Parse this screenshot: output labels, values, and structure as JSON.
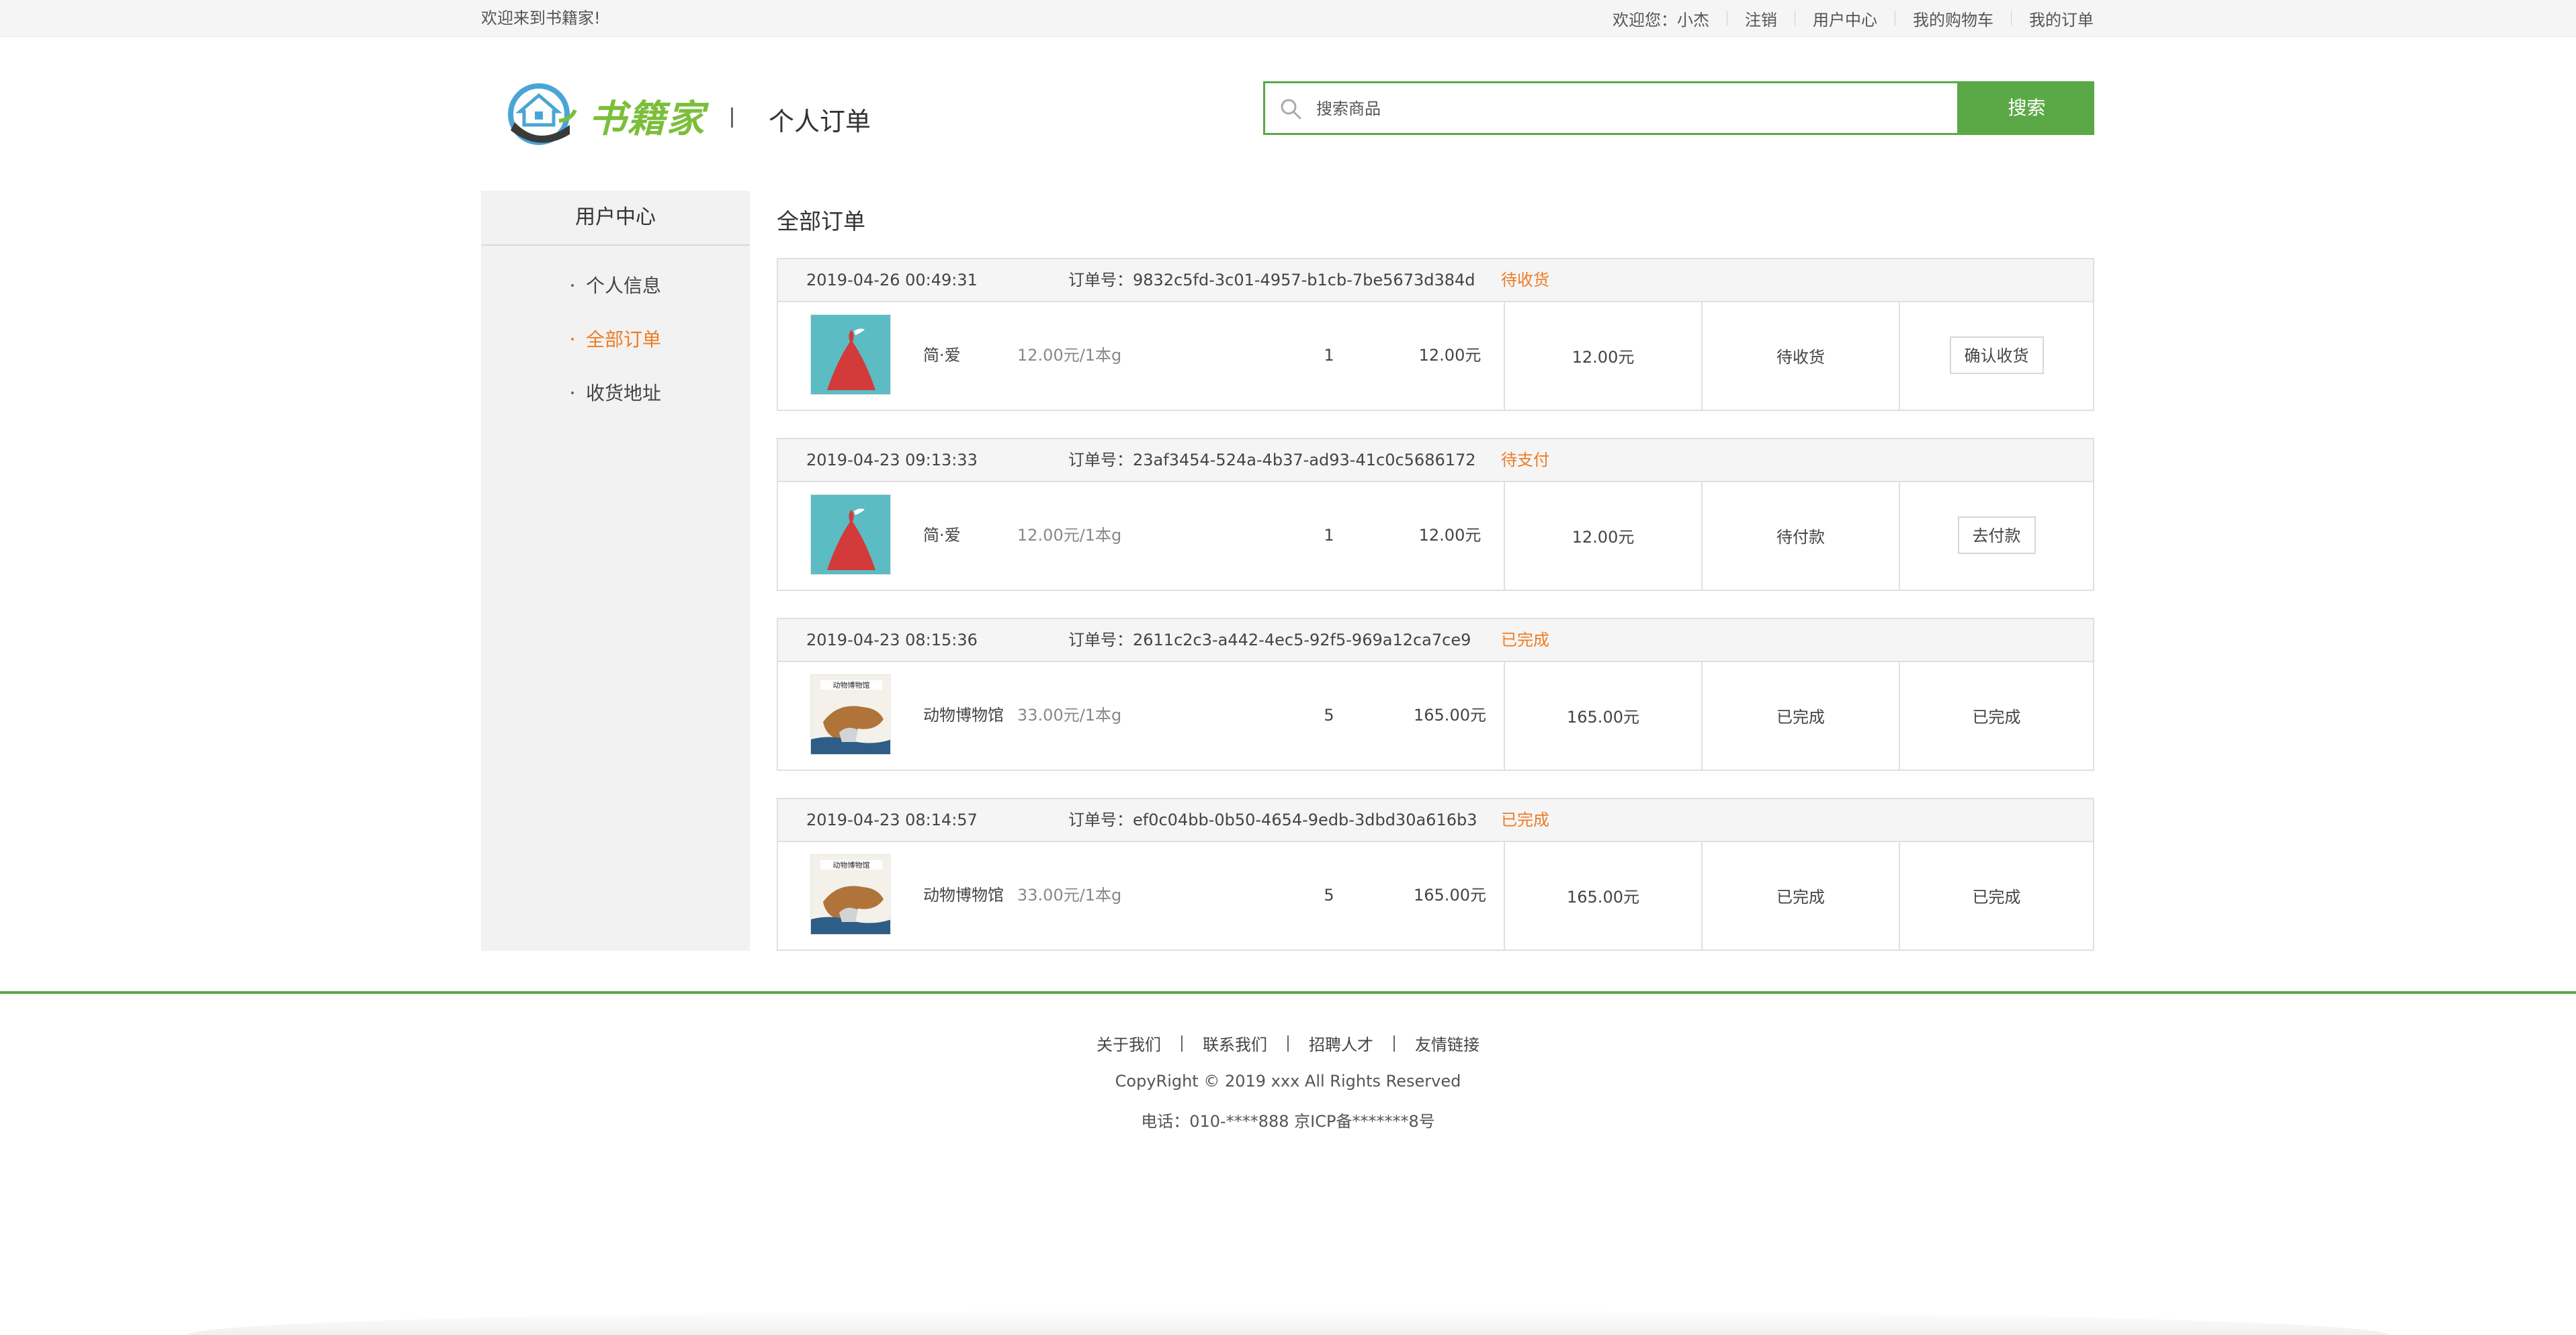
{
  "topbar": {
    "welcome": "欢迎来到书籍家!",
    "greeting": "欢迎您：小杰",
    "logout": "注销",
    "user_center": "用户中心",
    "cart": "我的购物车",
    "my_orders": "我的订单"
  },
  "header": {
    "logo_text": "书籍家",
    "title": "个人订单"
  },
  "search": {
    "placeholder": "搜索商品",
    "button": "搜索"
  },
  "sidebar": {
    "title": "用户中心",
    "items": [
      {
        "label": "个人信息",
        "active": false
      },
      {
        "label": "全部订单",
        "active": true
      },
      {
        "label": "收货地址",
        "active": false
      }
    ]
  },
  "main": {
    "title": "全部订单",
    "order_no_label": "订单号：",
    "orders": [
      {
        "date": "2019-04-26 00:49:31",
        "order_no": "9832c5fd-3c01-4957-b1cb-7be5673d384d",
        "status": "待收货",
        "book_name": "简·爱",
        "book_price": "12.00元/1本g",
        "qty": "1",
        "subtotal": "12.00元",
        "total": "12.00元",
        "state": "待收货",
        "action": "确认收货",
        "action_is_button": true,
        "cover": "jane-eyre"
      },
      {
        "date": "2019-04-23 09:13:33",
        "order_no": "23af3454-524a-4b37-ad93-41c0c5686172",
        "status": "待支付",
        "book_name": "简·爱",
        "book_price": "12.00元/1本g",
        "qty": "1",
        "subtotal": "12.00元",
        "total": "12.00元",
        "state": "待付款",
        "action": "去付款",
        "action_is_button": true,
        "cover": "jane-eyre"
      },
      {
        "date": "2019-04-23 08:15:36",
        "order_no": "2611c2c3-a442-4ec5-92f5-969a12ca7ce9",
        "status": "已完成",
        "book_name": "动物博物馆",
        "book_price": "33.00元/1本g",
        "qty": "5",
        "subtotal": "165.00元",
        "total": "165.00元",
        "state": "已完成",
        "action": "已完成",
        "action_is_button": false,
        "cover": "animal-museum"
      },
      {
        "date": "2019-04-23 08:14:57",
        "order_no": "ef0c04bb-0b50-4654-9edb-3dbd30a616b3",
        "status": "已完成",
        "book_name": "动物博物馆",
        "book_price": "33.00元/1本g",
        "qty": "5",
        "subtotal": "165.00元",
        "total": "165.00元",
        "state": "已完成",
        "action": "已完成",
        "action_is_button": false,
        "cover": "animal-museum"
      }
    ]
  },
  "footer": {
    "links": [
      "关于我们",
      "联系我们",
      "招聘人才",
      "友情链接"
    ],
    "copyright": "CopyRight © 2019 xxx All Rights Reserved",
    "phone": "电话：010-****888 京ICP备*******8号"
  },
  "colors": {
    "brand_green": "#5aa946",
    "accent_orange": "#ee7b24",
    "logo_green": "#7cbe3a"
  }
}
